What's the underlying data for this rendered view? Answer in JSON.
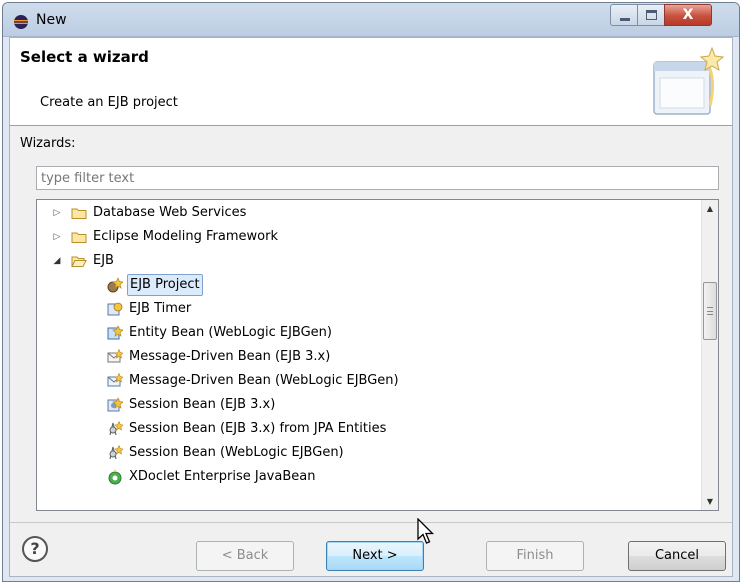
{
  "window": {
    "title": "New",
    "close_glyph": "X"
  },
  "header": {
    "title": "Select a wizard",
    "description": "Create an EJB project"
  },
  "wizards_label": "Wizards:",
  "filter": {
    "placeholder": "type filter text",
    "value": ""
  },
  "tree": {
    "items": [
      {
        "label": "Database Web Services",
        "icon": "folder-icon",
        "expander": "collapsed"
      },
      {
        "label": "Eclipse Modeling Framework",
        "icon": "folder-icon",
        "expander": "collapsed"
      },
      {
        "label": "EJB",
        "icon": "folder-open-icon",
        "expander": "expanded"
      },
      {
        "label": "EJB Project",
        "icon": "ejb-project-icon",
        "selected": true
      },
      {
        "label": "EJB Timer",
        "icon": "ejb-timer-icon"
      },
      {
        "label": "Entity Bean (WebLogic EJBGen)",
        "icon": "entity-bean-icon"
      },
      {
        "label": "Message-Driven Bean (EJB 3.x)",
        "icon": "message-bean-icon"
      },
      {
        "label": "Message-Driven Bean (WebLogic EJBGen)",
        "icon": "message-bean-icon"
      },
      {
        "label": "Session Bean (EJB 3.x)",
        "icon": "session-bean-icon"
      },
      {
        "label": "Session Bean (EJB 3.x) from JPA Entities",
        "icon": "session-bean-jpa-icon"
      },
      {
        "label": "Session Bean (WebLogic EJBGen)",
        "icon": "session-bean-jpa-icon"
      },
      {
        "label": "XDoclet Enterprise JavaBean",
        "icon": "xdoclet-icon"
      }
    ]
  },
  "buttons": {
    "help": "?",
    "back": "< Back",
    "next": "Next >",
    "finish": "Finish",
    "cancel": "Cancel"
  }
}
